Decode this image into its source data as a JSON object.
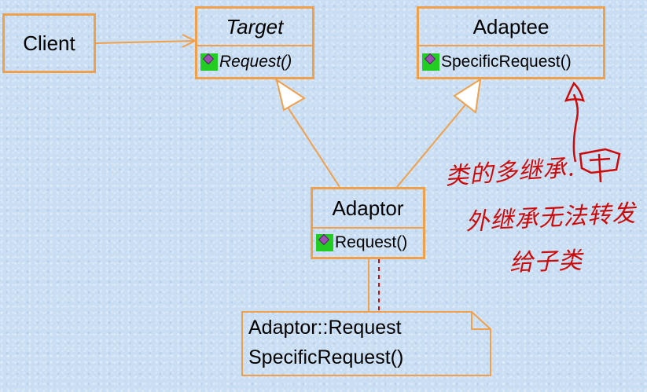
{
  "classes": {
    "client": {
      "name": "Client"
    },
    "target": {
      "name": "Target",
      "operation": "Request()"
    },
    "adaptee": {
      "name": "Adaptee",
      "operation": "SpecificRequest()"
    },
    "adaptor": {
      "name": "Adaptor",
      "operation": "Request()"
    }
  },
  "note": {
    "line1": "Adaptor::Request",
    "line2": "SpecificRequest()"
  },
  "handwriting": {
    "line1": "类的多继承.",
    "line2": "外继承无法转发",
    "line3": "给子类"
  },
  "colors": {
    "box_border": "#f0a04b",
    "operation_icon": "#22cc22",
    "handwriting": "#cc0a0a",
    "note_link": "#cc0a0a"
  }
}
